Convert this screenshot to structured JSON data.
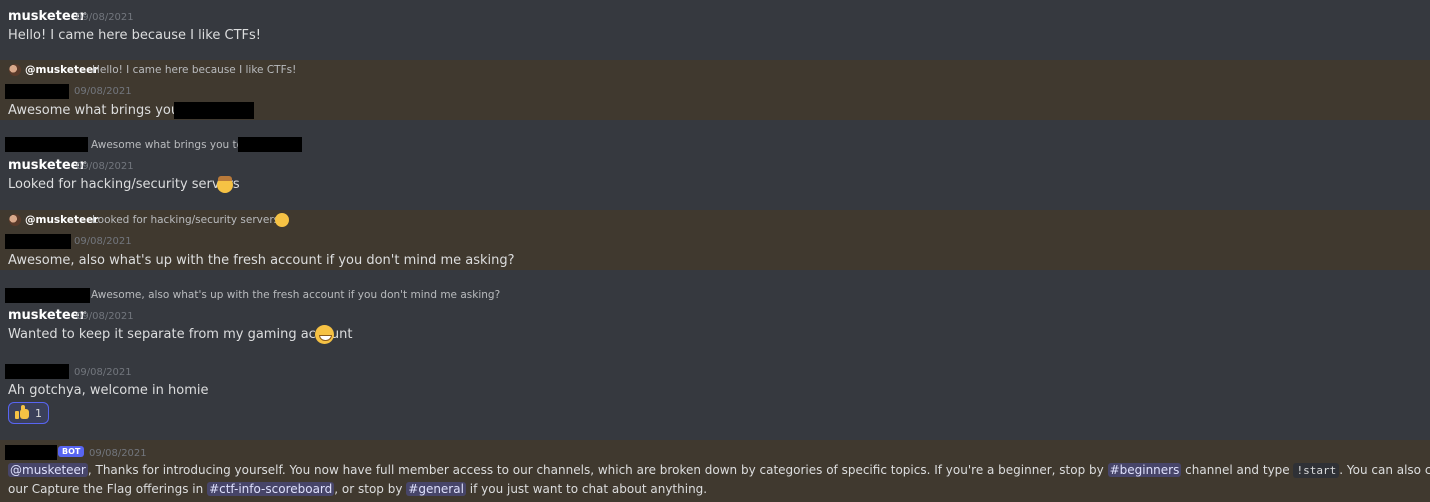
{
  "messages": {
    "m1": {
      "author": "musketeer",
      "timestamp": "09/08/2021",
      "text": "Hello! I came here because I like CTFs!"
    },
    "m2": {
      "reply_author": "@musketeer",
      "reply_text": "Hello! I came here because I like CTFs!",
      "timestamp": "09/08/2021",
      "text": "Awesome what brings you to"
    },
    "m3": {
      "reply_text": "Awesome what brings you to",
      "author": "musketeer",
      "timestamp": "09/08/2021",
      "text": "Looked for hacking/security servers"
    },
    "m4": {
      "reply_author": "@musketeer",
      "reply_text": "Looked for hacking/security servers",
      "timestamp": "09/08/2021",
      "text": "Awesome, also what's up with the fresh account if you don't mind me asking?"
    },
    "m5": {
      "reply_text": "Awesome, also what's up with the fresh account if you don't mind me asking?",
      "author": "musketeer",
      "timestamp": "09/08/2021",
      "text": "Wanted to  keep it separate from my gaming account"
    },
    "m6": {
      "timestamp": "09/08/2021",
      "text": "Ah gotchya, welcome in homie",
      "reaction_count": "1",
      "reaction_icon": "thumbs-up-icon"
    },
    "m7": {
      "bot_tag": "BOT",
      "timestamp": "09/08/2021",
      "mention_user": "@musketeer",
      "text_a": ", Thanks for introducing yourself. You now have full member access to our channels, which are broken down by categories of specific topics. If you're a beginner, stop by ",
      "channel_beginners": "#beginners",
      "text_b": " channel and type ",
      "command": "!start",
      "text_c": ". You can also check out",
      "text_d": "our Capture the Flag offerings in ",
      "channel_ctf": "#ctf-info-scoreboard",
      "text_e": ",  or stop by ",
      "channel_general": "#general",
      "text_f": " if you just want to chat about anything."
    }
  },
  "colors": {
    "background": "#36393f",
    "highlight": "#40392f",
    "mention": "#5865f2"
  }
}
